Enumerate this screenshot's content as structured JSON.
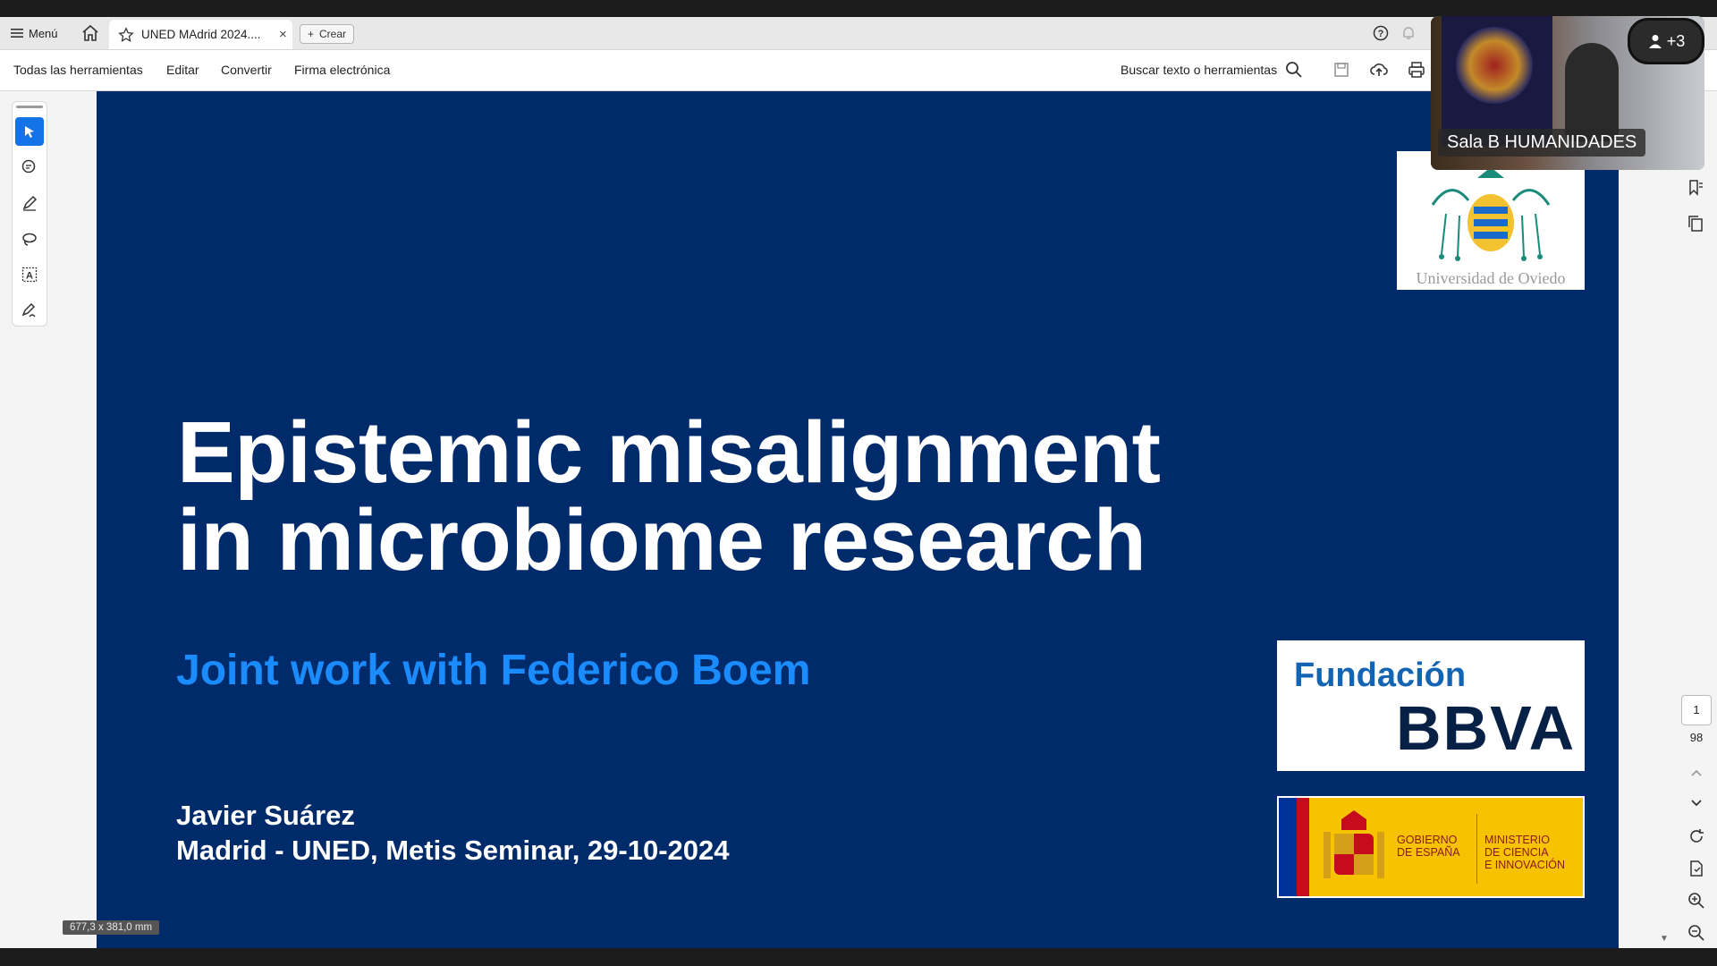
{
  "tabbar": {
    "menu_label": "Menú",
    "tab_title": "UNED MAdrid 2024....",
    "tab_close": "×",
    "create_label": "Crear"
  },
  "toolbar": {
    "items": [
      "Todas las herramientas",
      "Editar",
      "Convertir",
      "Firma electrónica"
    ],
    "search_label": "Buscar texto o herramientas"
  },
  "slide": {
    "title_line1": "Epistemic misalignment",
    "title_line2": "in microbiome research",
    "subtitle": "Joint work with Federico Boem",
    "author": "Javier Suárez",
    "venue": "Madrid - UNED, Metis Seminar, 29-10-2024",
    "logos": {
      "oviedo": "Universidad de Oviedo",
      "bbva_top": "Fundación",
      "bbva_bottom": "BBVA",
      "gob_left": "GOBIERNO\nDE ESPAÑA",
      "gob_right": "MINISTERIO\nDE CIENCIA\nE INNOVACIÓN"
    },
    "colors": {
      "background": "#002b6b",
      "subtitle": "#1a8cff"
    }
  },
  "status": {
    "page_dimensions": "677,3 x 381,0 mm"
  },
  "pager": {
    "current": "1",
    "total": "98"
  },
  "video": {
    "name": "Sala B HUMANIDADES",
    "participants": "+3"
  }
}
